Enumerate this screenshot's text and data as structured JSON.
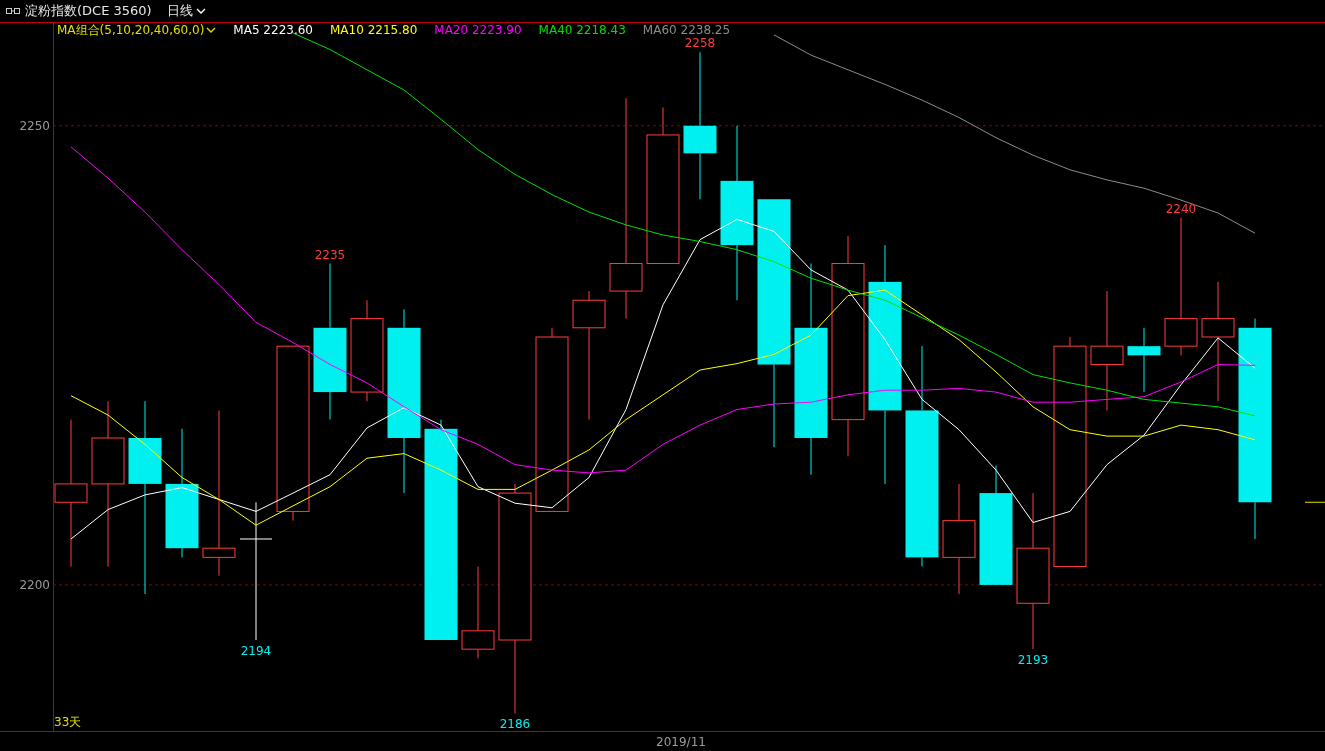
{
  "header": {
    "title": "淀粉指数(DCE 3560)",
    "period": "日线"
  },
  "chart": {
    "legend_title": "MA组合(5,10,20,40,60,0)",
    "legend": [
      {
        "value": "2223.60"
      },
      {
        "value": "2215.80"
      },
      {
        "value": "2223.90"
      },
      {
        "value": "2218.43"
      },
      {
        "value": "2238.25"
      }
    ],
    "bar_count": "33天",
    "x_axis_label": "2019/11",
    "chart_data": {
      "type": "line",
      "ylim": [
        2184.2,
        2261.3
      ],
      "yticks": [
        {
          "value": 2200,
          "label": "2200"
        },
        {
          "value": 2250,
          "label": "2250"
        }
      ],
      "series": [
        {
          "name": "MA5",
          "color": "#ffffff",
          "values": [
            2205.0,
            2208.2,
            2209.8,
            2210.6,
            2209.3,
            2208.0,
            2210.0,
            2212.0,
            2217.1,
            2219.3,
            2217.4,
            2210.7,
            2208.9,
            2208.4,
            2211.7,
            2219.1,
            2230.5,
            2237.6,
            2239.8,
            2238.5,
            2234.3,
            2232.1,
            2226.7,
            2220.2,
            2216.9,
            2212.5,
            2206.8,
            2208.0,
            2213.1,
            2216.3,
            2221.8,
            2226.9,
            2223.6
          ]
        },
        {
          "name": "MA10",
          "color": "#ffff00",
          "values": [
            2220.6,
            2218.5,
            2215.3,
            2211.7,
            2209.3,
            2206.5,
            2208.6,
            2210.7,
            2213.8,
            2214.3,
            2212.5,
            2210.4,
            2210.4,
            2212.5,
            2214.7,
            2218.0,
            2220.7,
            2223.4,
            2224.1,
            2225.1,
            2227.2,
            2231.5,
            2232.1,
            2229.4,
            2226.7,
            2223.2,
            2219.4,
            2216.9,
            2216.2,
            2216.2,
            2217.4,
            2216.9,
            2215.8
          ]
        },
        {
          "name": "MA20",
          "color": "#ff00ff",
          "values": [
            2247.7,
            2244.3,
            2240.6,
            2236.5,
            2232.7,
            2228.6,
            2226.4,
            2224.0,
            2222.0,
            2219.4,
            2216.9,
            2215.3,
            2213.1,
            2212.5,
            2212.2,
            2212.5,
            2215.3,
            2217.4,
            2219.1,
            2219.7,
            2219.9,
            2220.7,
            2221.2,
            2221.2,
            2221.4,
            2221.0,
            2219.9,
            2219.9,
            2220.2,
            2220.5,
            2222.1,
            2224.0,
            2223.9
          ]
        },
        {
          "name": "MA40",
          "color": "#00e000",
          "values": [
            null,
            null,
            null,
            null,
            null,
            null,
            2260.1,
            2258.3,
            2256.1,
            2253.9,
            2250.7,
            2247.4,
            2244.7,
            2242.5,
            2240.6,
            2239.2,
            2238.1,
            2237.4,
            2236.5,
            2235.2,
            2233.4,
            2232.1,
            2231.0,
            2229.1,
            2227.2,
            2225.1,
            2222.9,
            2222.0,
            2221.2,
            2220.2,
            2219.8,
            2219.4,
            2218.4
          ]
        },
        {
          "name": "MA60",
          "color": "#8c8c8c",
          "values": [
            null,
            null,
            null,
            null,
            null,
            null,
            null,
            null,
            null,
            null,
            null,
            null,
            null,
            null,
            null,
            null,
            null,
            null,
            null,
            2259.9,
            2257.7,
            2256.1,
            2254.5,
            2252.8,
            2250.9,
            2248.7,
            2246.8,
            2245.2,
            2244.1,
            2243.2,
            2241.9,
            2240.5,
            2238.3
          ]
        }
      ],
      "annotations": [
        {
          "text": "2194"
        },
        {
          "text": "2235"
        },
        {
          "text": "2186"
        },
        {
          "text": "2258"
        },
        {
          "text": "2193"
        },
        {
          "text": "2240"
        }
      ]
    }
  }
}
